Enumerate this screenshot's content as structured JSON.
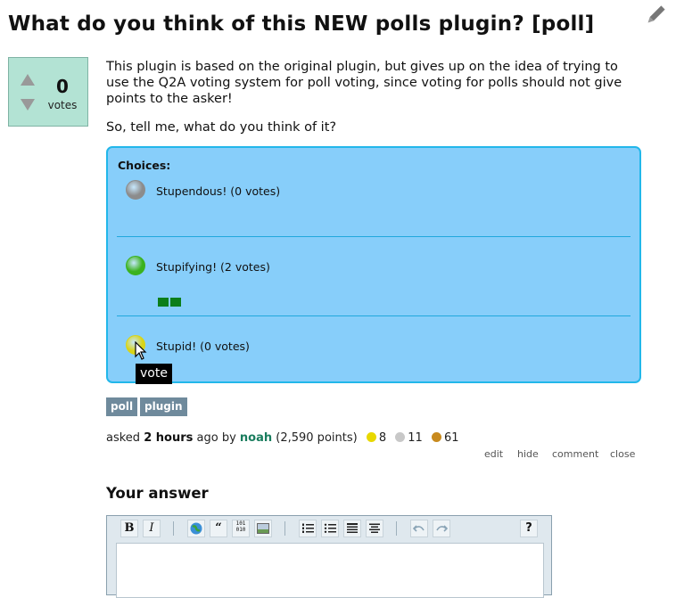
{
  "question": {
    "title": "What do you think of this NEW polls plugin? [poll]",
    "vote_count": "0",
    "vote_label": "votes",
    "body_paragraph_1": "This plugin is based on the original plugin, but gives up on the idea of trying to use the Q2A voting system for poll voting, since voting for polls should not give points to the asker!",
    "body_paragraph_2": "So, tell me, what do you think of it?"
  },
  "poll": {
    "choices_label": "Choices:",
    "choices": [
      {
        "label": "Stupendous! (0 votes)",
        "votes": 0,
        "color": "#8c8c8c"
      },
      {
        "label": "Stupifying! (2 votes)",
        "votes": 2,
        "color": "#3bb21e"
      },
      {
        "label": "Stupid! (0 votes)",
        "votes": 0,
        "color": "#d8d418"
      }
    ],
    "tooltip": "vote"
  },
  "tags": [
    "poll",
    "plugin"
  ],
  "meta": {
    "asked": "asked",
    "when": "2 hours",
    "ago_by": "ago by",
    "user": "noah",
    "points": "(2,590 points)",
    "badges": [
      {
        "color": "#e8d800",
        "count": "8"
      },
      {
        "color": "#c8c8c8",
        "count": "11"
      },
      {
        "color": "#c88a1e",
        "count": "61"
      }
    ]
  },
  "actions": [
    "edit",
    "hide",
    "comment",
    "close"
  ],
  "answer": {
    "heading": "Your answer",
    "toolbar": {
      "bold": "B",
      "italic": "I",
      "quote": "“",
      "binary": "101 010",
      "help": "?"
    }
  },
  "colors": {
    "poll_bg": "#87cefa",
    "poll_border": "#22b7ea",
    "vote_bg": "#b3e3d4",
    "tag_bg": "#6f8a9c",
    "user_link": "#1a7d5e"
  }
}
